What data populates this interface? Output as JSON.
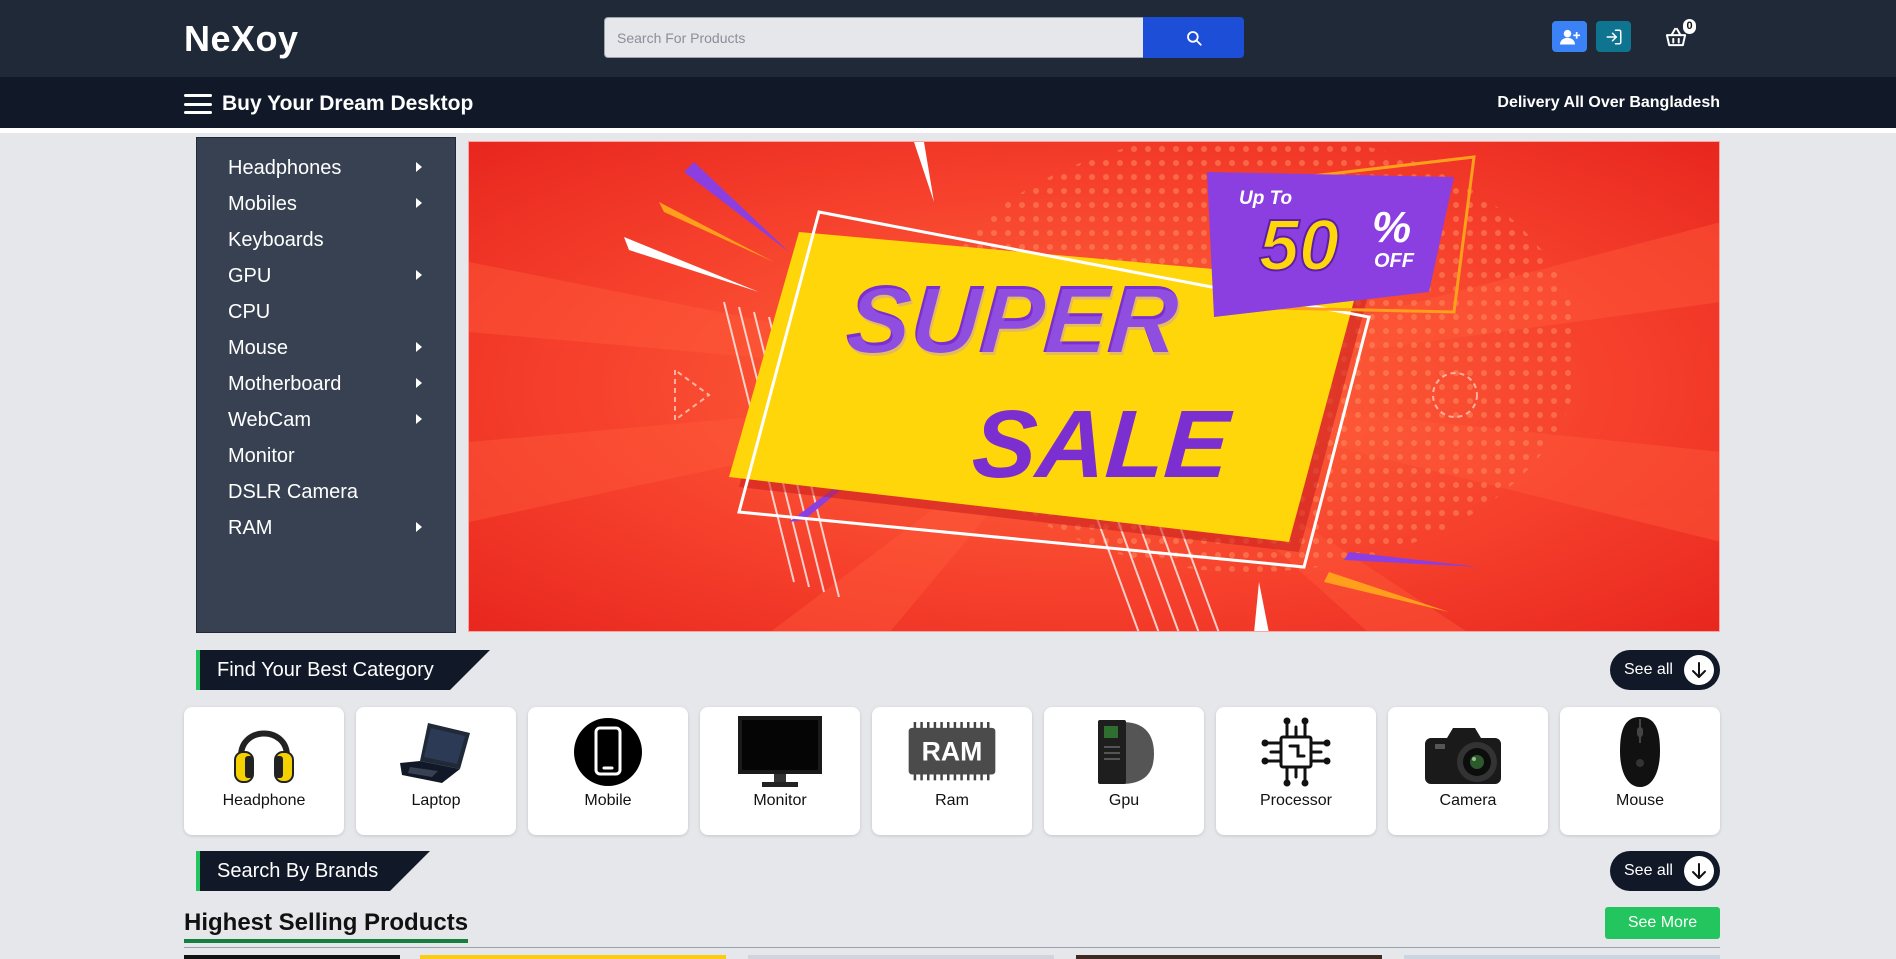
{
  "header": {
    "logo": "NeXoy",
    "search_placeholder": "Search For Products",
    "cart_count": "0",
    "icons": [
      "user-plus-icon",
      "login-icon",
      "shopping-basket-icon",
      "search-icon"
    ]
  },
  "navbar": {
    "title": "Buy Your Dream Desktop",
    "delivery": "Delivery All Over Bangladesh"
  },
  "sidebar": {
    "items": [
      {
        "label": "Headphones",
        "has_submenu": true
      },
      {
        "label": "Mobiles",
        "has_submenu": true
      },
      {
        "label": "Keyboards",
        "has_submenu": false
      },
      {
        "label": "GPU",
        "has_submenu": true
      },
      {
        "label": "CPU",
        "has_submenu": false
      },
      {
        "label": "Mouse",
        "has_submenu": true
      },
      {
        "label": "Motherboard",
        "has_submenu": true
      },
      {
        "label": "WebCam",
        "has_submenu": true
      },
      {
        "label": "Monitor",
        "has_submenu": false
      },
      {
        "label": "DSLR Camera",
        "has_submenu": false
      },
      {
        "label": "RAM",
        "has_submenu": true
      }
    ]
  },
  "banner": {
    "up_to": "Up To",
    "percent": "50",
    "percent_sign": "%",
    "off": "OFF",
    "line1": "SUPER",
    "line2": "SALE"
  },
  "categories_section": {
    "title": "Find Your Best Category",
    "see_all": "See all",
    "items": [
      {
        "label": "Headphone",
        "icon": "headphone-icon"
      },
      {
        "label": "Laptop",
        "icon": "laptop-icon"
      },
      {
        "label": "Mobile",
        "icon": "mobile-icon"
      },
      {
        "label": "Monitor",
        "icon": "monitor-icon"
      },
      {
        "label": "Ram",
        "icon": "ram-icon",
        "icon_text": "RAM"
      },
      {
        "label": "Gpu",
        "icon": "gpu-icon"
      },
      {
        "label": "Processor",
        "icon": "processor-icon"
      },
      {
        "label": "Camera",
        "icon": "camera-icon"
      },
      {
        "label": "Mouse",
        "icon": "mouse-icon"
      }
    ]
  },
  "brands_section": {
    "title": "Search By Brands",
    "see_all": "See all"
  },
  "products_section": {
    "title": "Highest Selling Products",
    "see_more": "See More"
  },
  "colors": {
    "header_bg": "#1f2937",
    "navbar_bg": "#111827",
    "sidebar_bg": "#374151",
    "search_button": "#1d4ed8",
    "accent_green": "#22c55e",
    "banner_red": "#f03a2e",
    "banner_yellow": "#ffd60a",
    "banner_purple": "#8b3fe0"
  }
}
